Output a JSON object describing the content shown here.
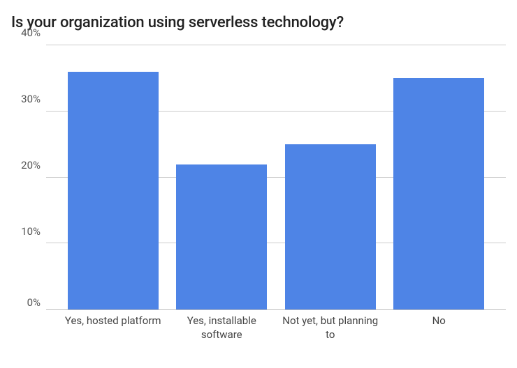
{
  "chart_data": {
    "type": "bar",
    "title": "Is your organization using serverless technology?",
    "categories": [
      "Yes, hosted platform",
      "Yes, installable software",
      "Not yet, but planning to",
      "No"
    ],
    "values": [
      36,
      22,
      25,
      35
    ],
    "xlabel": "",
    "ylabel": "",
    "ylim": [
      0,
      40
    ],
    "yticks": [
      0,
      10,
      20,
      30,
      40
    ],
    "ytick_labels": [
      "0%",
      "10%",
      "20%",
      "30%",
      "40%"
    ],
    "bar_color": "#4e84e6"
  }
}
